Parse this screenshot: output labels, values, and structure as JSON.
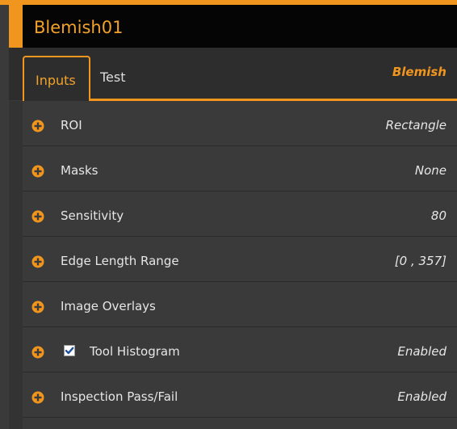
{
  "tool": {
    "title": "Blemish01",
    "type_label": "Blemish"
  },
  "tabs": [
    {
      "label": "Inputs",
      "active": true
    },
    {
      "label": "Test",
      "active": false
    }
  ],
  "rows": [
    {
      "label": "ROI",
      "value": "Rectangle",
      "icon": "plus-circle-icon"
    },
    {
      "label": "Masks",
      "value": "None",
      "icon": "plus-circle-icon"
    },
    {
      "label": "Sensitivity",
      "value": "80",
      "icon": "plus-circle-icon"
    },
    {
      "label": "Edge Length Range",
      "value": "[0 , 357]",
      "icon": "plus-circle-icon"
    },
    {
      "label": "Image Overlays",
      "value": "",
      "icon": "plus-circle-icon"
    },
    {
      "label": "Tool Histogram",
      "value": "Enabled",
      "icon": "plus-circle-icon",
      "checked": true
    },
    {
      "label": "Inspection Pass/Fail",
      "value": "Enabled",
      "icon": "plus-circle-icon"
    }
  ],
  "colors": {
    "accent": "#f0951e",
    "title_bar": "#050505",
    "panel": "#3a3a3a",
    "text": "#e6e6e6"
  }
}
